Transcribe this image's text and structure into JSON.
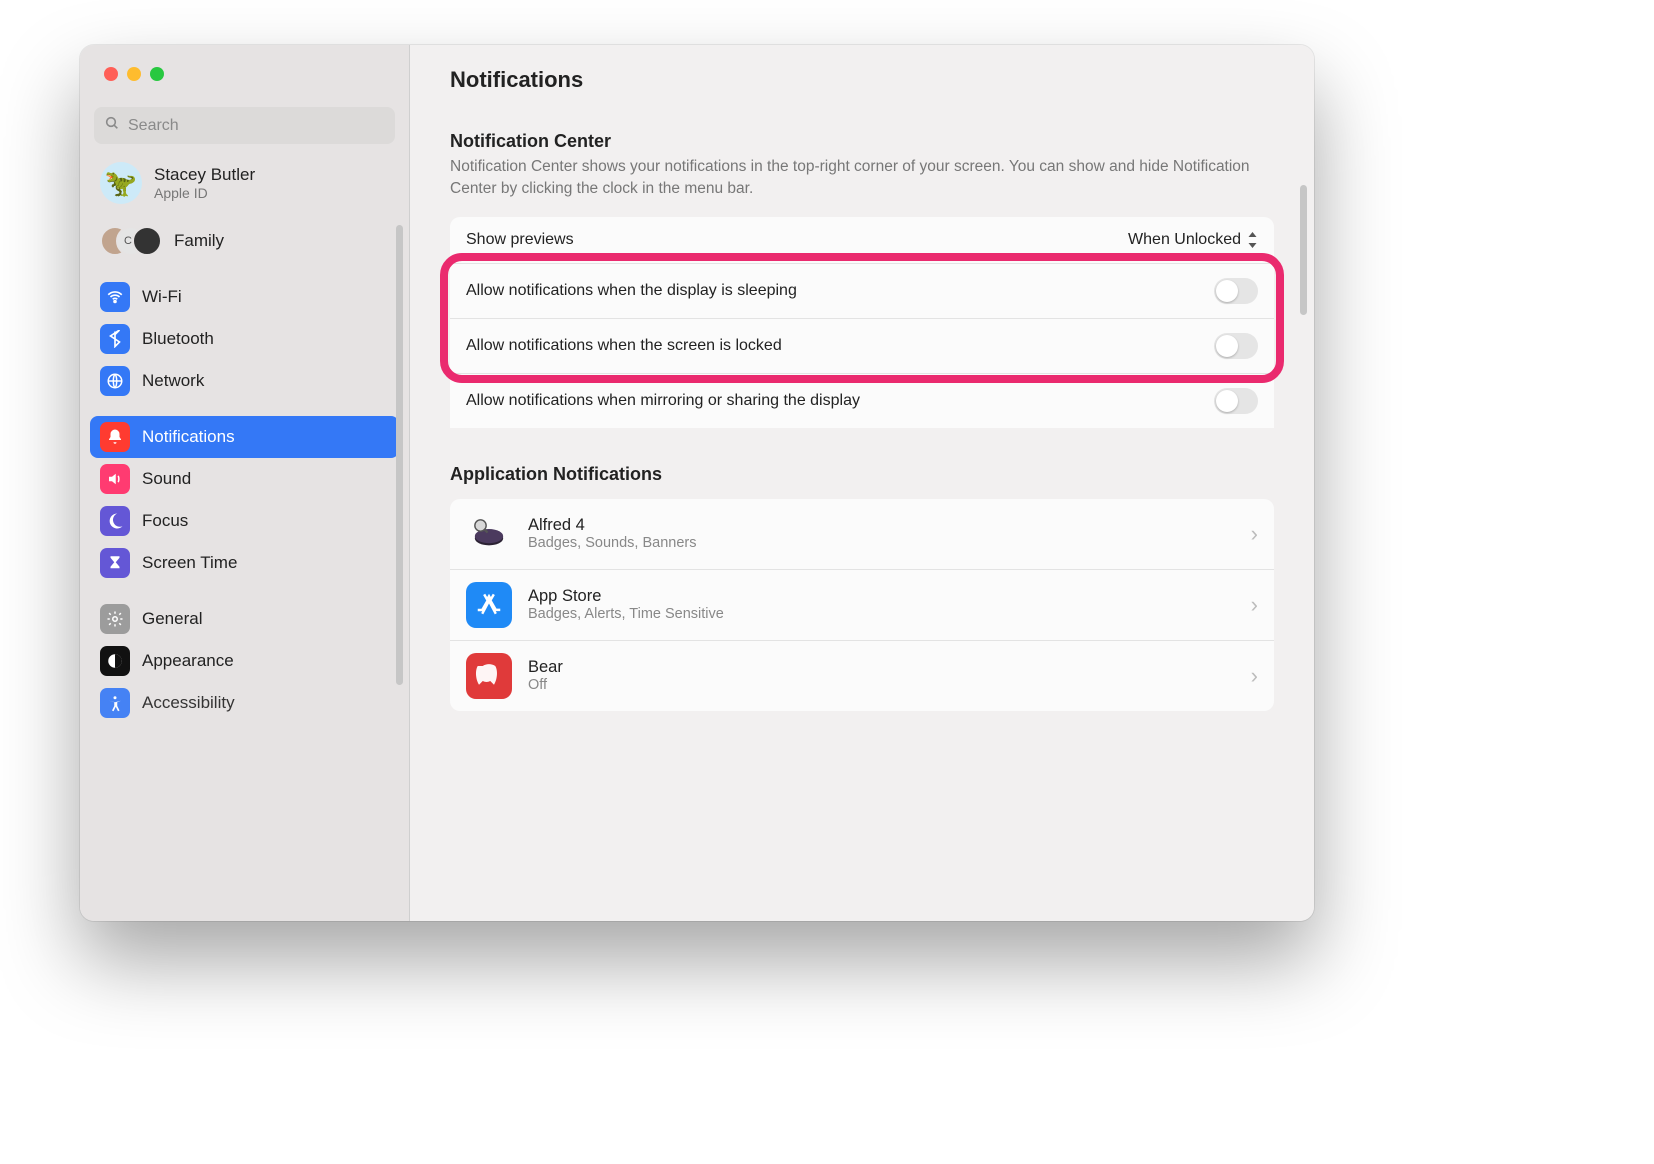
{
  "window": {
    "title": "Notifications"
  },
  "search": {
    "placeholder": "Search"
  },
  "apple": {
    "name": "Stacey Butler",
    "sub": "Apple ID"
  },
  "family": {
    "label": "Family"
  },
  "sidebar": {
    "groups": [
      {
        "items": [
          {
            "icon": "wifi-icon",
            "label": "Wi-Fi",
            "bg": "#3478f6",
            "selected": false
          },
          {
            "icon": "bluetooth-icon",
            "label": "Bluetooth",
            "bg": "#3478f6",
            "selected": false
          },
          {
            "icon": "network-icon",
            "label": "Network",
            "bg": "#3478f6",
            "selected": false
          }
        ]
      },
      {
        "items": [
          {
            "icon": "bell-icon",
            "label": "Notifications",
            "bg": "#ff3b30",
            "selected": true
          },
          {
            "icon": "sound-icon",
            "label": "Sound",
            "bg": "#ff3b71",
            "selected": false
          },
          {
            "icon": "focus-icon",
            "label": "Focus",
            "bg": "#6457d6",
            "selected": false
          },
          {
            "icon": "screentime-icon",
            "label": "Screen Time",
            "bg": "#6457d6",
            "selected": false
          }
        ]
      },
      {
        "items": [
          {
            "icon": "general-icon",
            "label": "General",
            "bg": "#9c9c9c",
            "selected": false
          },
          {
            "icon": "appearance-icon",
            "label": "Appearance",
            "bg": "#111",
            "selected": false
          },
          {
            "icon": "accessibility-icon",
            "label": "Accessibility",
            "bg": "#3478f6",
            "selected": false,
            "clipped": true
          }
        ]
      }
    ]
  },
  "notif_center": {
    "title": "Notification Center",
    "desc": "Notification Center shows your notifications in the top-right corner of your screen. You can show and hide Notification Center by clicking the clock in the menu bar.",
    "rows": [
      {
        "label": "Show previews",
        "type": "select",
        "value": "When Unlocked"
      },
      {
        "label": "Allow notifications when the display is sleeping",
        "type": "toggle",
        "on": false,
        "highlight": true
      },
      {
        "label": "Allow notifications when the screen is locked",
        "type": "toggle",
        "on": false,
        "highlight": true
      },
      {
        "label": "Allow notifications when mirroring or sharing the display",
        "type": "toggle",
        "on": false,
        "highlight": false
      }
    ]
  },
  "app_notifs": {
    "title": "Application Notifications",
    "apps": [
      {
        "name": "Alfred 4",
        "sub": "Badges, Sounds, Banners",
        "icon": "alfred-icon",
        "bg": "#2b2233"
      },
      {
        "name": "App Store",
        "sub": "Badges, Alerts, Time Sensitive",
        "icon": "appstore-icon",
        "bg": "#1f8af6"
      },
      {
        "name": "Bear",
        "sub": "Off",
        "icon": "bear-icon",
        "bg": "#e03a3a"
      }
    ]
  },
  "colors": {
    "highlight": "#ea2a6e",
    "accent": "#3478f6"
  }
}
